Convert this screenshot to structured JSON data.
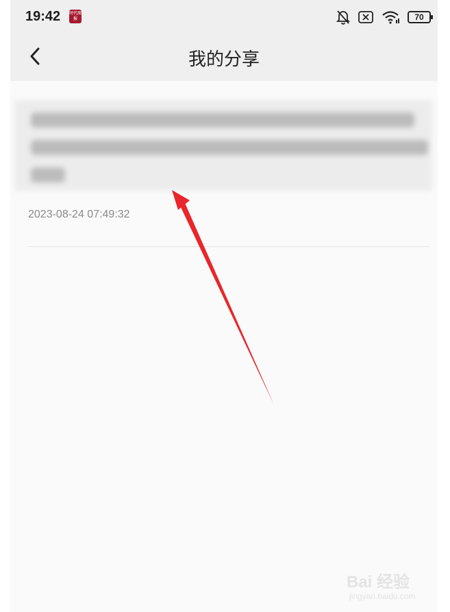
{
  "status_bar": {
    "time": "19:42",
    "app_badge_text": "时代周报",
    "battery_level": "70",
    "icons": [
      "notifications-off-icon",
      "sim-x-icon",
      "wifi-icon",
      "battery-icon"
    ]
  },
  "nav": {
    "back_icon": "chevron-left-icon",
    "title": "我的分享"
  },
  "share_list": [
    {
      "content": "",
      "date": "2023-08-24 07:49:32"
    }
  ],
  "watermark": {
    "brand": "Bai 经验",
    "site": "jingyan.baidu.com"
  },
  "colors": {
    "arrow": "#e8262b",
    "badge": "#a6192e",
    "background": "#fafafa"
  }
}
